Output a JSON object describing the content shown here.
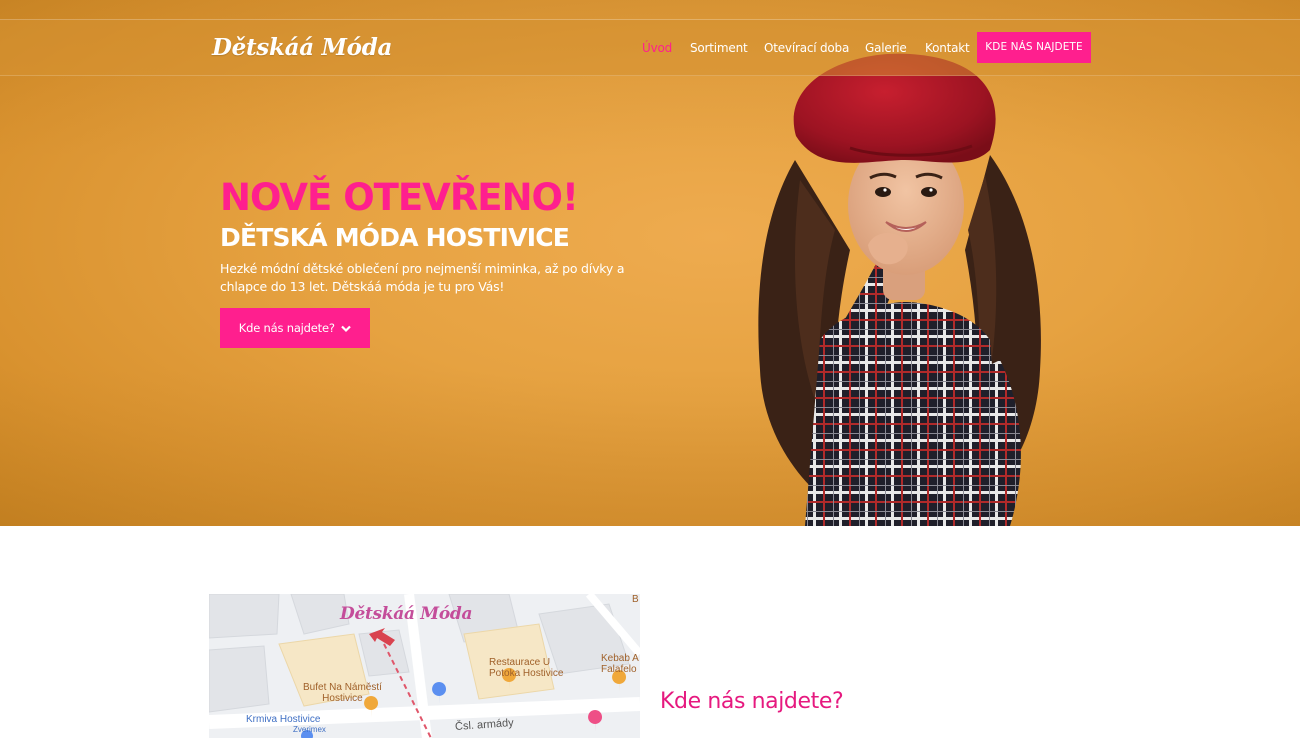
{
  "header": {
    "logo": "Dětskáá Móda",
    "nav": [
      {
        "label": "Úvod",
        "active": true
      },
      {
        "label": "Sortiment",
        "active": false
      },
      {
        "label": "Otevírací doba",
        "active": false
      },
      {
        "label": "Galerie",
        "active": false
      },
      {
        "label": "Kontakt",
        "active": false
      }
    ],
    "cta_label": "KDE NÁS NAJDETE"
  },
  "hero": {
    "headline": "NOVĚ OTEVŘENO!",
    "subheadline": "DĚTSKÁ MÓDA HOSTIVICE",
    "lead": "Hezké módní dětské oblečení pro nejmenší miminka, až po dívky a chlapce do 13 let. Dětskáá móda je tu pro Vás!",
    "button_label": "Kde nás najdete?",
    "button_icon": "chevron-down-icon"
  },
  "location": {
    "title": "Kde nás najdete?",
    "map": {
      "logo": "Dětskáá Móda",
      "labels": {
        "restaurant": [
          "Restaurace U",
          "Potoka Hostivice"
        ],
        "bufet": [
          "Bufet Na Náměstí",
          "Hostivice"
        ],
        "kebab": [
          "Kebab A",
          "Falafelo"
        ],
        "krmiva": "Krmiva Hostivice",
        "zverimex": "Zverimex",
        "street": "Čsl. armády",
        "corner": "B"
      }
    }
  },
  "colors": {
    "accent": "#ff1f8e",
    "hero_bg": "#e6a241",
    "title_pink": "#e6197f"
  }
}
